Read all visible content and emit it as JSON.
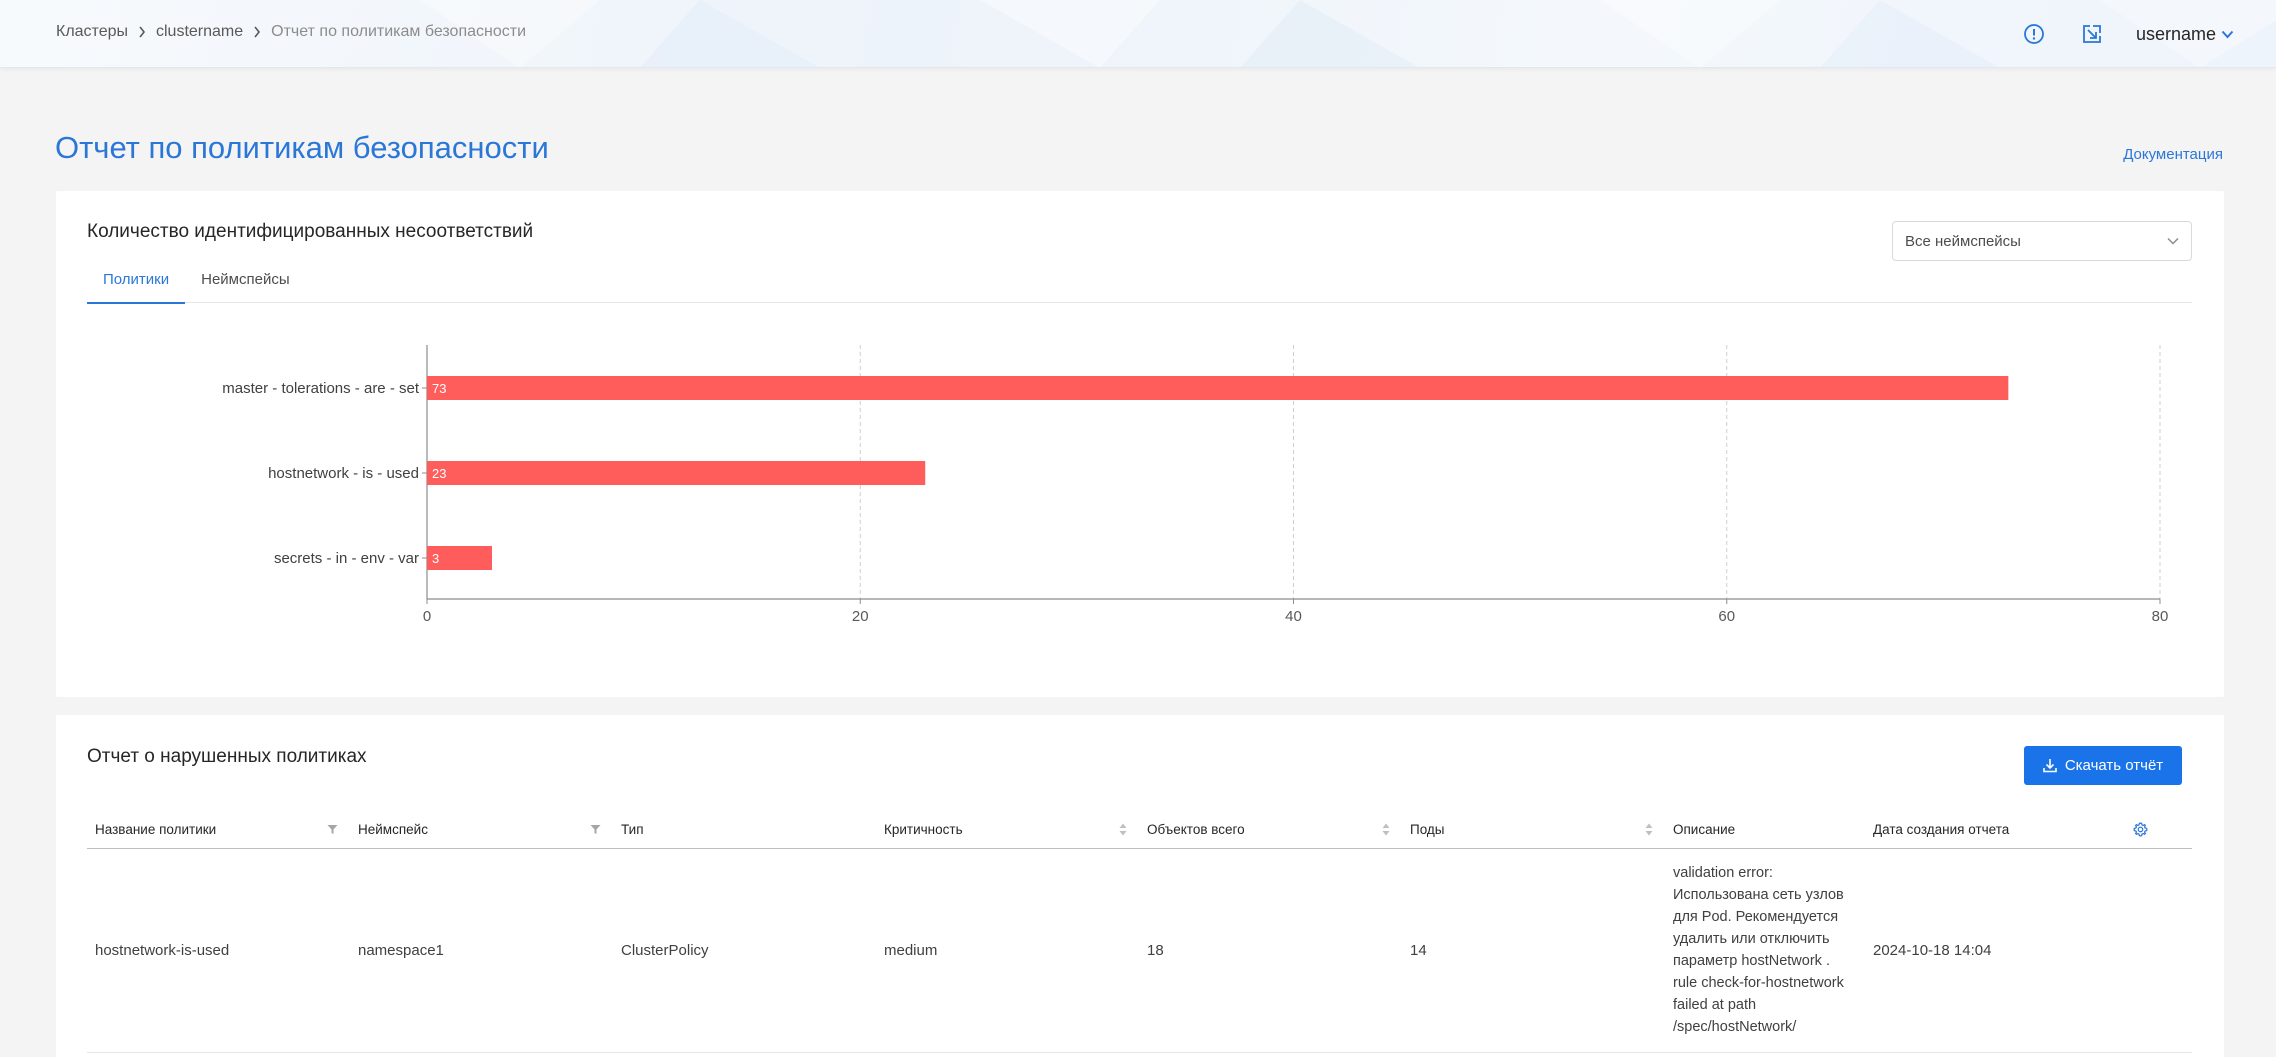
{
  "breadcrumb": {
    "items": [
      "Кластеры",
      "clustername",
      "Отчет по политикам безопасности"
    ]
  },
  "header": {
    "username": "username",
    "icons": [
      "info-circle-icon",
      "external-link-icon",
      "chevron-down-icon"
    ]
  },
  "page": {
    "title": "Отчет по политикам безопасности",
    "doc_link": "Документация"
  },
  "summary": {
    "title": "Количество идентифицированных несоответствий",
    "namespace_select": {
      "value": "Все неймспейсы"
    },
    "tabs": [
      {
        "label": "Политики",
        "active": true
      },
      {
        "label": "Неймспейсы",
        "active": false
      }
    ]
  },
  "chart_data": {
    "type": "bar",
    "orientation": "horizontal",
    "categories": [
      "master - tolerations - are - set",
      "hostnetwork - is - used",
      "secrets - in - env - var"
    ],
    "values": [
      73,
      23,
      3
    ],
    "bar_color": "#ff5c5c",
    "xlim": [
      0,
      80
    ],
    "xticks": [
      0,
      20,
      40,
      60,
      80
    ],
    "grid": "vertical dashed"
  },
  "report": {
    "title": "Отчет о нарушенных политиках",
    "download_label": "Скачать отчёт",
    "columns": [
      "Название политики",
      "Неймспейс",
      "Тип",
      "Критичность",
      "Объектов всего",
      "Поды",
      "Описание",
      "Дата создания отчета"
    ],
    "rows": [
      {
        "policy": "hostnetwork-is-used",
        "namespace": "namespace1",
        "type": "ClusterPolicy",
        "severity": "medium",
        "objects_total": "18",
        "pods": "14",
        "description": "validation error: Использована сеть узлов для Pod. Рекомендуется удалить или отключить параметр hostNetwork . rule check-for-hostnetwork failed at path /spec/hostNetwork/",
        "created": "2024-10-18 14:04"
      }
    ]
  },
  "colors": {
    "accent": "#2a77d8",
    "primary_button": "#1a73e8",
    "bar": "#ff5c5c"
  }
}
